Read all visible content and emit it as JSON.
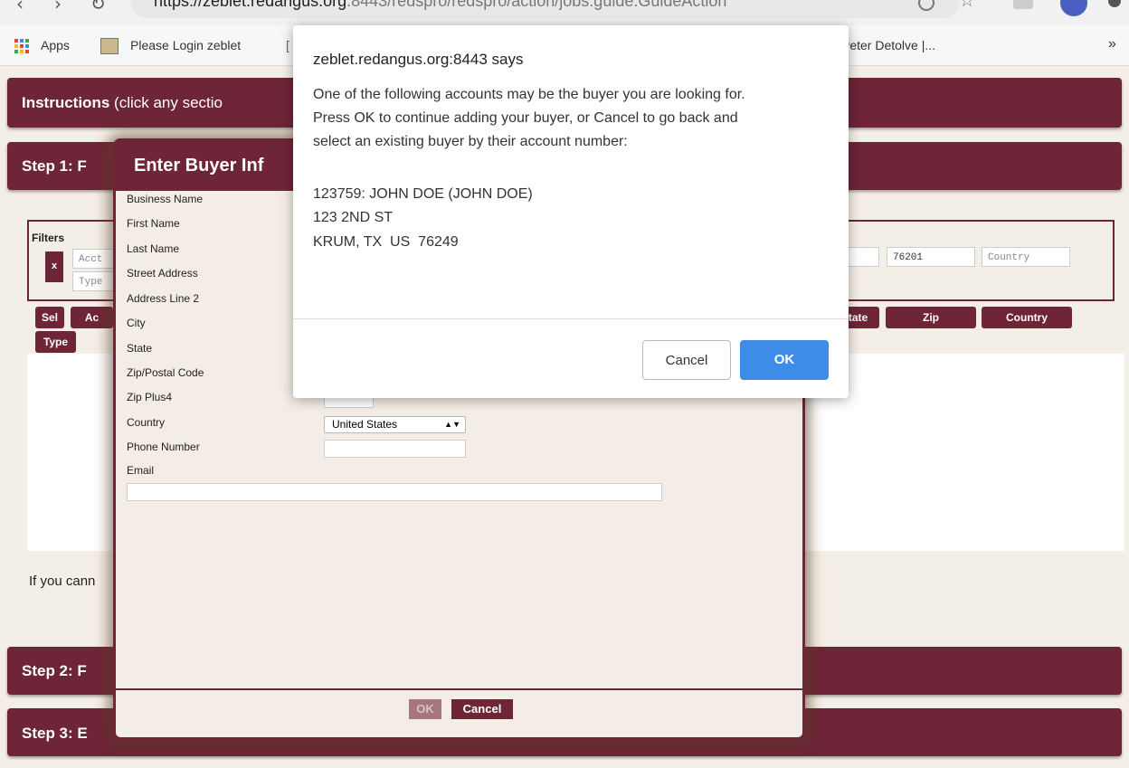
{
  "browser": {
    "url_host": "https://zeblet.redangus.org",
    "url_path": ":8443/redspro/redspro/action/jobs.guide.GuideAction",
    "bookmarks": [
      "Apps",
      "Please Login zeblet",
      "Peter Detolve |..."
    ],
    "overflow": "»"
  },
  "page": {
    "instructions_title": "Instructions",
    "instructions_hint": "(click any sectio",
    "step1_title": "Step 1: F",
    "step2_title": "Step 2: F",
    "step3_title": "Step 3: E",
    "filters_label": "Filters",
    "filter_clear": "x",
    "filter_account_placeholder": "Acct",
    "filter_type_placeholder": "Type",
    "filter_state_value": "",
    "filter_zip_value": "76201",
    "filter_country_placeholder": "Country",
    "columns": {
      "sel": "Sel",
      "acct": "Ac",
      "type": "Type",
      "state": "tate",
      "zip": "Zip",
      "country": "Country"
    },
    "footer_text": "If you cann"
  },
  "buyer_modal": {
    "title": "Enter Buyer Inf",
    "labels": {
      "business": "Business Name",
      "first": "First Name",
      "last": "Last Name",
      "street": "Street Address",
      "line2": "Address Line 2",
      "city": "City",
      "state": "State",
      "zip": "Zip/Postal Code",
      "zip4": "Zip Plus4",
      "country": "Country",
      "phone": "Phone Number",
      "email": "Email"
    },
    "country_value": "United States",
    "ok_label": "OK",
    "cancel_label": "Cancel"
  },
  "dialog": {
    "origin": "zeblet.redangus.org:8443 says",
    "message_line1": "One of the following accounts may be the buyer you are looking for.",
    "message_line2": "Press OK to continue adding your buyer, or Cancel to go back and",
    "message_line3": "select an existing buyer by their account number:",
    "account_line1": "123759: JOHN DOE (JOHN DOE)",
    "account_line2": "123 2ND ST",
    "account_line3": "KRUM, TX  US  76249",
    "cancel_label": "Cancel",
    "ok_label": "OK"
  },
  "colors": {
    "brand": "#6e2537",
    "primary_button": "#3d8ce8"
  }
}
